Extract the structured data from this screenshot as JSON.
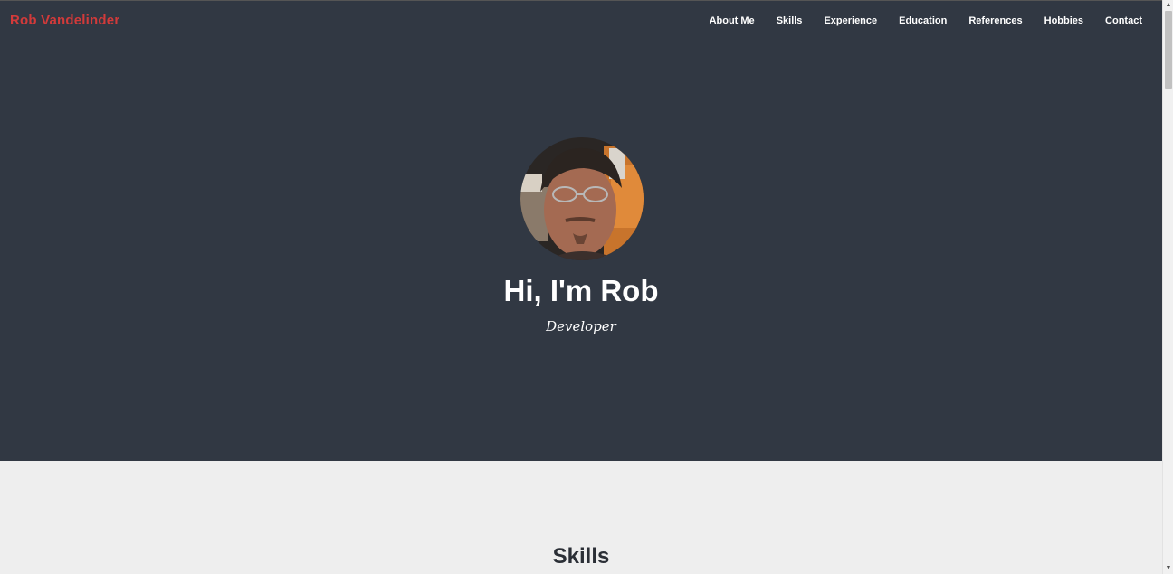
{
  "navbar": {
    "brand": "Rob Vandelinder",
    "links": [
      "About Me",
      "Skills",
      "Experience",
      "Education",
      "References",
      "Hobbies",
      "Contact"
    ]
  },
  "hero": {
    "headline": "Hi, I'm Rob",
    "subtitle": "Developer"
  },
  "skills": {
    "title": "Skills"
  },
  "colors": {
    "hero_bg": "#313843",
    "brand": "#d23a3a",
    "section_bg": "#eeeeee"
  }
}
